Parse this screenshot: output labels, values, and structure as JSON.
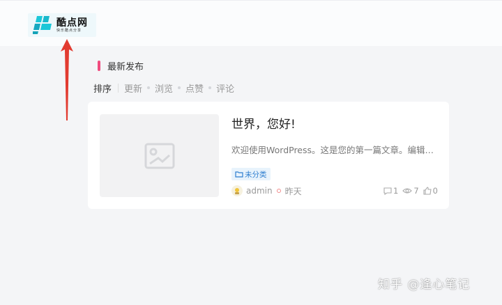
{
  "site": {
    "name": "酷点网",
    "slogan": "快乐酷点分享"
  },
  "feed": {
    "section_title": "最新发布",
    "sort_label": "排序",
    "sort_options": [
      "更新",
      "浏览",
      "点赞",
      "评论"
    ]
  },
  "post": {
    "title": "世界，您好!",
    "excerpt": "欢迎使用WordPress。这是您的第一篇文章。编辑或删除它，然后开始写作吧！",
    "category": "未分类",
    "author": "admin",
    "time": "昨天",
    "comments": "1",
    "views": "7",
    "likes": "0"
  },
  "watermark": "知乎 @逢心笔记",
  "colors": {
    "accent_pink": "#f04b7e",
    "logo_cyan": "#1cc7d8",
    "badge_blue": "#2f7fd0",
    "arrow_red": "#e23b30"
  }
}
